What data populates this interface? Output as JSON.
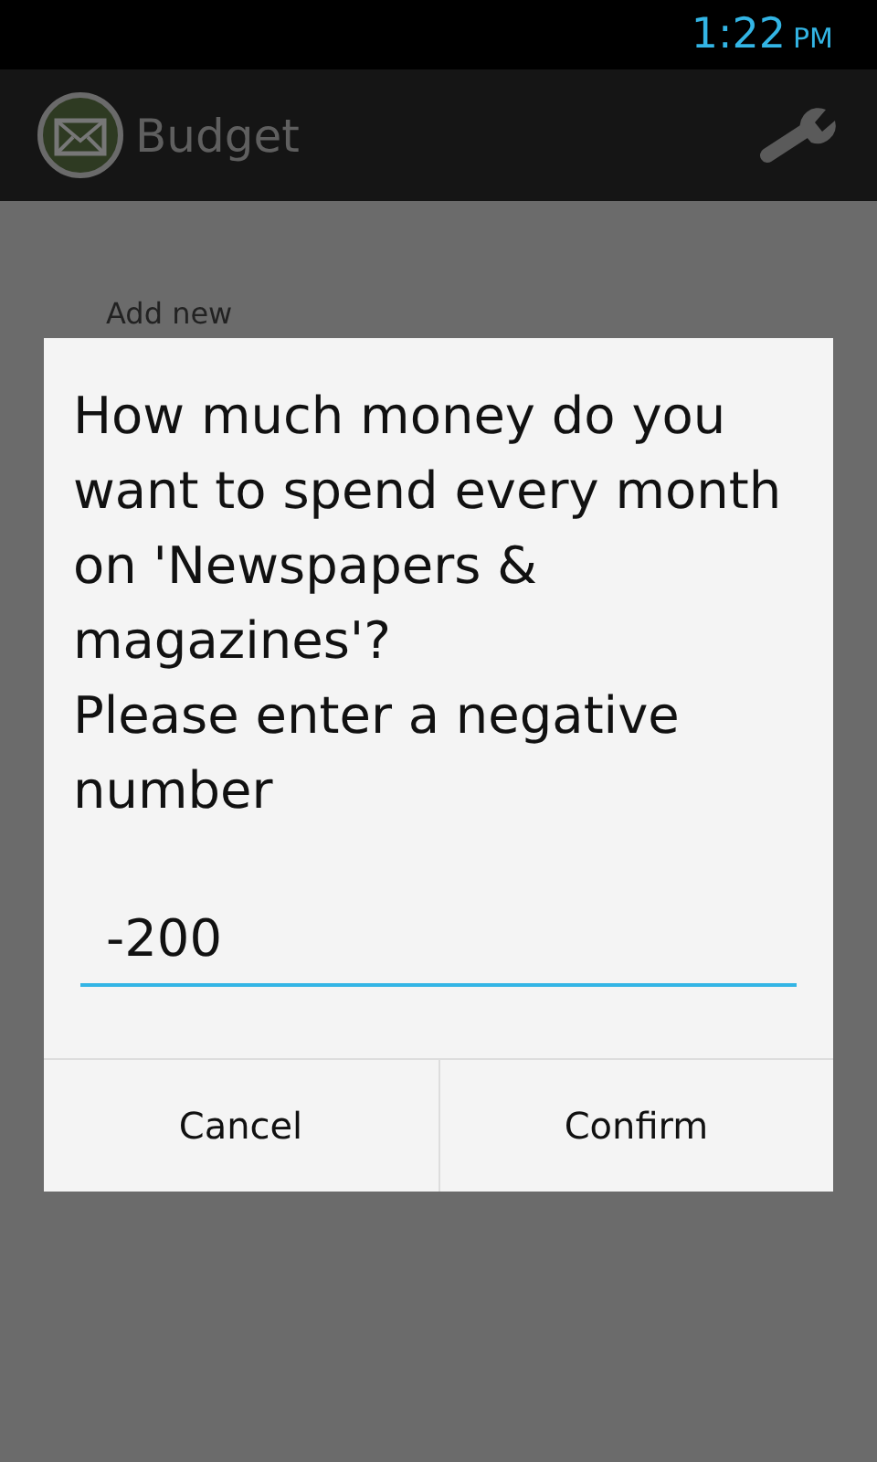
{
  "status_bar": {
    "time": "1:22",
    "period": "PM"
  },
  "action_bar": {
    "title": "Budget"
  },
  "content": {
    "add_new": "Add new"
  },
  "dialog": {
    "question": "How much money do you want to spend every month on 'Newspapers & magazines'?",
    "hint": "Please enter a negative number",
    "input": {
      "value": "-200"
    },
    "buttons": [
      "Cancel",
      "Confirm"
    ]
  }
}
